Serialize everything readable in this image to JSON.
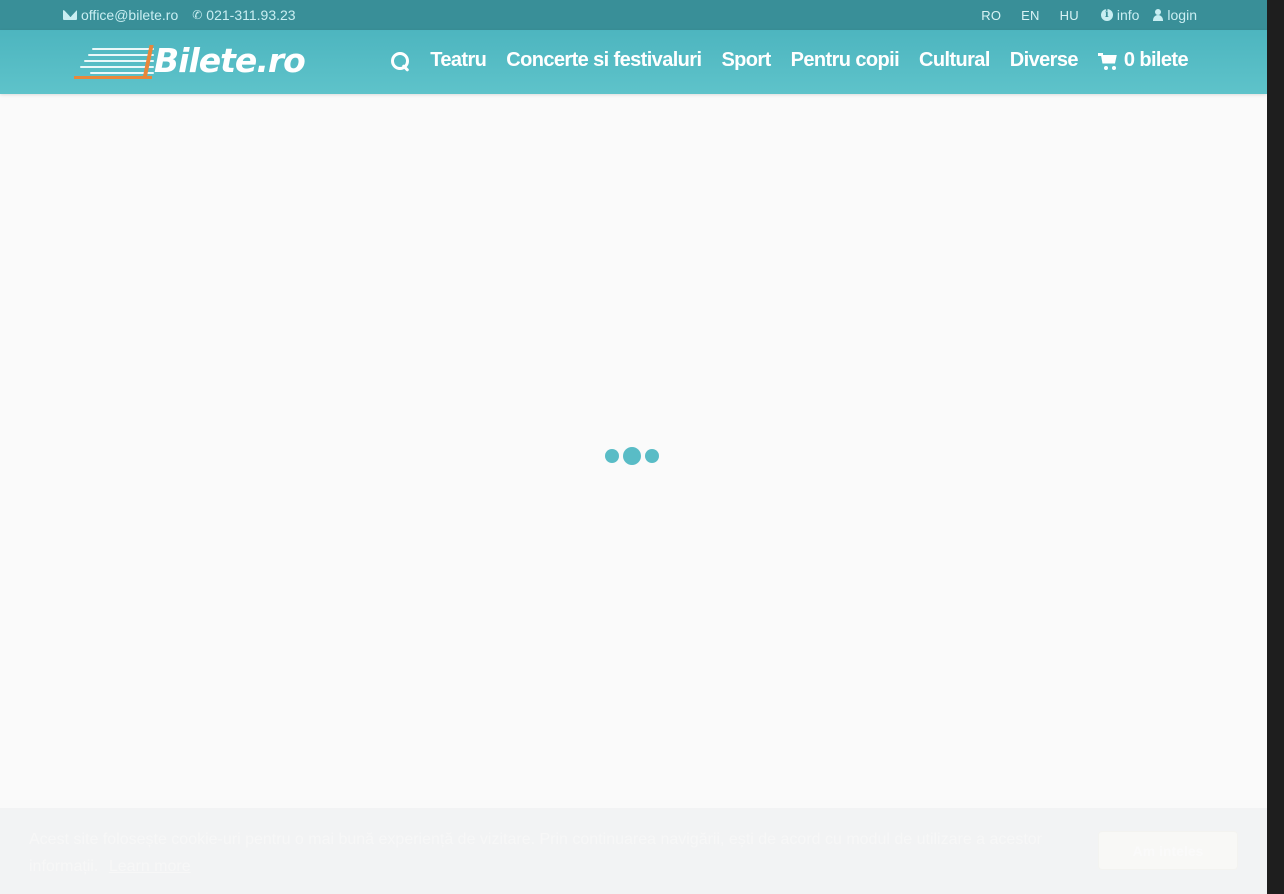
{
  "topbar": {
    "email": "office@bilete.ro",
    "phone": "021-311.93.23",
    "languages": [
      "RO",
      "EN",
      "HU"
    ],
    "info_label": "info",
    "login_label": "login"
  },
  "navbar": {
    "logo_text": "Bilete.ro",
    "items": [
      "Teatru",
      "Concerte si festivaluri",
      "Sport",
      "Pentru copii",
      "Cultural",
      "Diverse"
    ],
    "cart_label": "0 bilete"
  },
  "cookie": {
    "message": "Acest site folosește cookie-uri pentru o mai bună experiență de vizitare. Prin continuarea navigării, ești de acord cu modul de utilizare a acestor informații.",
    "link_label": "Learn more",
    "button_label": "Am inteles"
  },
  "colors": {
    "topbar_bg": "#398f98",
    "navbar_bg": "#5ec3ca",
    "accent_orange": "#e8873a",
    "loader_dot": "#59bcc6"
  },
  "icons": [
    "envelope-icon",
    "phone-icon",
    "info-icon",
    "user-icon",
    "search-icon",
    "cart-icon"
  ]
}
